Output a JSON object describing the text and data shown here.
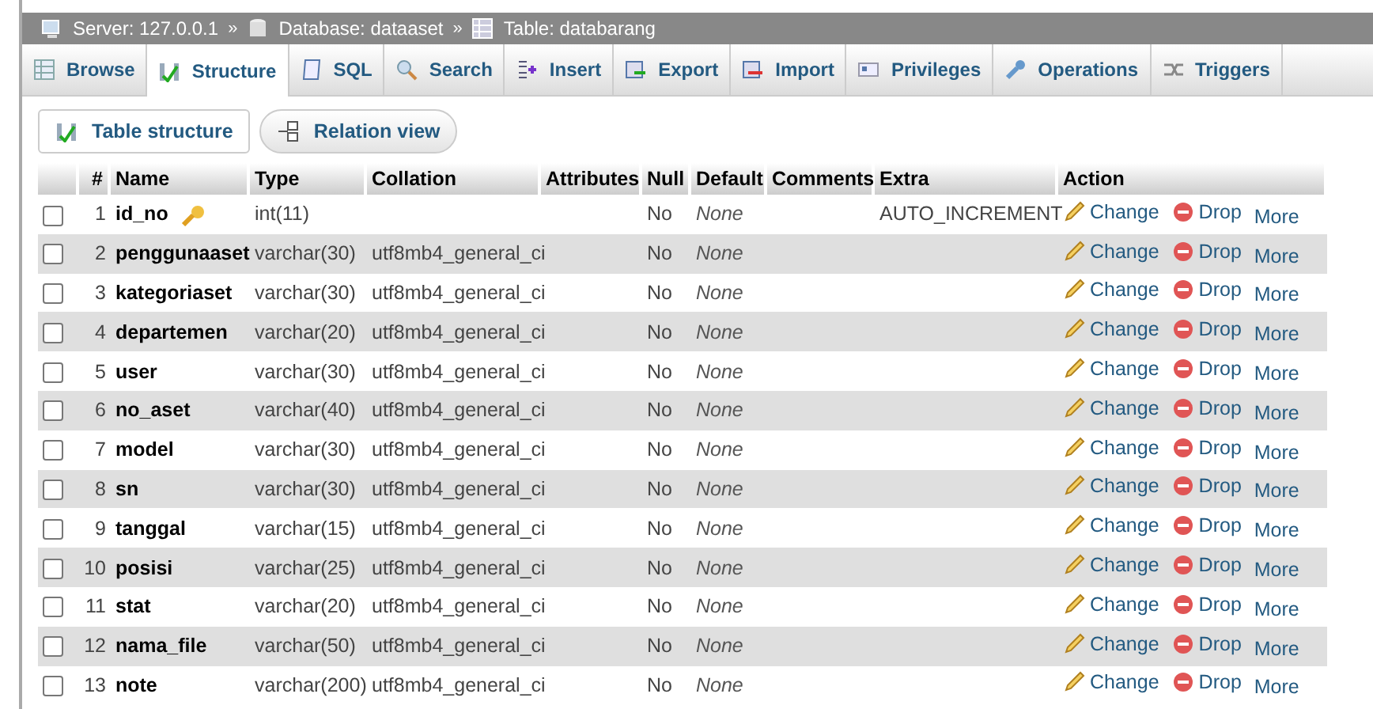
{
  "breadcrumb": [
    {
      "kind": "server",
      "label": "Server: 127.0.0.1"
    },
    {
      "kind": "database",
      "label": "Database: dataaset"
    },
    {
      "kind": "table",
      "label": "Table: databarang"
    }
  ],
  "breadcrumb_separator": "»",
  "tabs": [
    {
      "kind": "browse",
      "label": "Browse",
      "selected": false
    },
    {
      "kind": "structure",
      "label": "Structure",
      "selected": true
    },
    {
      "kind": "sql",
      "label": "SQL",
      "selected": false
    },
    {
      "kind": "search",
      "label": "Search",
      "selected": false
    },
    {
      "kind": "insert",
      "label": "Insert",
      "selected": false
    },
    {
      "kind": "export",
      "label": "Export",
      "selected": false
    },
    {
      "kind": "import",
      "label": "Import",
      "selected": false
    },
    {
      "kind": "privileges",
      "label": "Privileges",
      "selected": false
    },
    {
      "kind": "operations",
      "label": "Operations",
      "selected": false
    },
    {
      "kind": "triggers",
      "label": "Triggers",
      "selected": false
    }
  ],
  "subtabs": [
    {
      "kind": "structure",
      "label": "Table structure",
      "selected": true
    },
    {
      "kind": "relation",
      "label": "Relation view",
      "selected": false
    }
  ],
  "table": {
    "columns": [
      "#",
      "Name",
      "Type",
      "Collation",
      "Attributes",
      "Null",
      "Default",
      "Comments",
      "Extra",
      "Action"
    ],
    "rows": [
      {
        "num": "1",
        "name": "id_no",
        "primary": true,
        "type": "int(11)",
        "collation": "",
        "null": "No",
        "default": "None",
        "extra": "AUTO_INCREMENT",
        "checked": false,
        "actions": [
          "Change",
          "Drop",
          "More"
        ]
      },
      {
        "num": "2",
        "name": "penggunaaset",
        "primary": false,
        "type": "varchar(30)",
        "collation": "utf8mb4_general_ci",
        "null": "No",
        "default": "None",
        "extra": "",
        "checked": false,
        "actions": [
          "Change",
          "Drop",
          "More"
        ]
      },
      {
        "num": "3",
        "name": "kategoriaset",
        "primary": false,
        "type": "varchar(30)",
        "collation": "utf8mb4_general_ci",
        "null": "No",
        "default": "None",
        "extra": "",
        "checked": false,
        "actions": [
          "Change",
          "Drop",
          "More"
        ]
      },
      {
        "num": "4",
        "name": "departemen",
        "primary": false,
        "type": "varchar(20)",
        "collation": "utf8mb4_general_ci",
        "null": "No",
        "default": "None",
        "extra": "",
        "checked": false,
        "actions": [
          "Change",
          "Drop",
          "More"
        ]
      },
      {
        "num": "5",
        "name": "user",
        "primary": false,
        "type": "varchar(30)",
        "collation": "utf8mb4_general_ci",
        "null": "No",
        "default": "None",
        "extra": "",
        "checked": false,
        "actions": [
          "Change",
          "Drop",
          "More"
        ]
      },
      {
        "num": "6",
        "name": "no_aset",
        "primary": false,
        "type": "varchar(40)",
        "collation": "utf8mb4_general_ci",
        "null": "No",
        "default": "None",
        "extra": "",
        "checked": false,
        "actions": [
          "Change",
          "Drop",
          "More"
        ]
      },
      {
        "num": "7",
        "name": "model",
        "primary": false,
        "type": "varchar(30)",
        "collation": "utf8mb4_general_ci",
        "null": "No",
        "default": "None",
        "extra": "",
        "checked": false,
        "actions": [
          "Change",
          "Drop",
          "More"
        ]
      },
      {
        "num": "8",
        "name": "sn",
        "primary": false,
        "type": "varchar(30)",
        "collation": "utf8mb4_general_ci",
        "null": "No",
        "default": "None",
        "extra": "",
        "checked": false,
        "actions": [
          "Change",
          "Drop",
          "More"
        ]
      },
      {
        "num": "9",
        "name": "tanggal",
        "primary": false,
        "type": "varchar(15)",
        "collation": "utf8mb4_general_ci",
        "null": "No",
        "default": "None",
        "extra": "",
        "checked": false,
        "actions": [
          "Change",
          "Drop",
          "More"
        ]
      },
      {
        "num": "10",
        "name": "posisi",
        "primary": false,
        "type": "varchar(25)",
        "collation": "utf8mb4_general_ci",
        "null": "No",
        "default": "None",
        "extra": "",
        "checked": false,
        "actions": [
          "Change",
          "Drop",
          "More"
        ]
      },
      {
        "num": "11",
        "name": "stat",
        "primary": false,
        "type": "varchar(20)",
        "collation": "utf8mb4_general_ci",
        "null": "No",
        "default": "None",
        "extra": "",
        "checked": false,
        "actions": [
          "Change",
          "Drop",
          "More"
        ]
      },
      {
        "num": "12",
        "name": "nama_file",
        "primary": false,
        "type": "varchar(50)",
        "collation": "utf8mb4_general_ci",
        "null": "No",
        "default": "None",
        "extra": "",
        "checked": false,
        "actions": [
          "Change",
          "Drop",
          "More"
        ]
      },
      {
        "num": "13",
        "name": "note",
        "primary": false,
        "type": "varchar(200)",
        "collation": "utf8mb4_general_ci",
        "null": "No",
        "default": "None",
        "extra": "",
        "checked": false,
        "actions": [
          "Change",
          "Drop",
          "More"
        ]
      }
    ]
  }
}
